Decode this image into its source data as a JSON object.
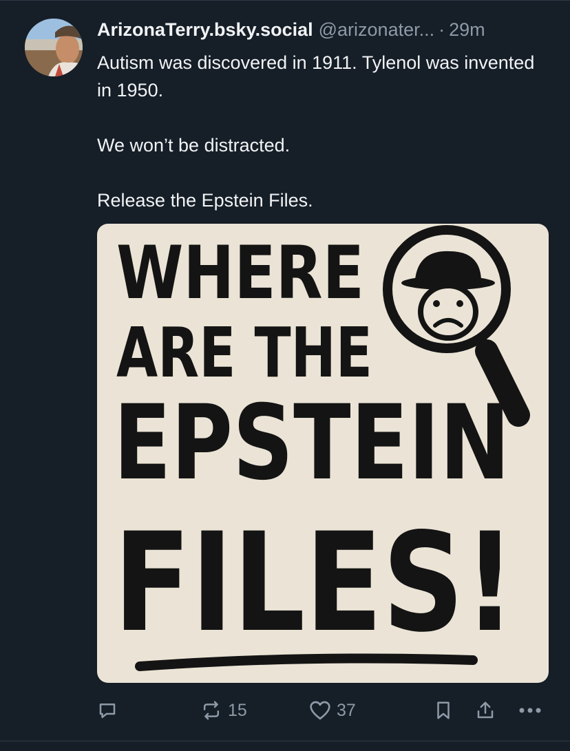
{
  "post": {
    "author": {
      "display_name": "ArizonaTerry.bsky.social",
      "handle": "@arizonater...",
      "separator": "·",
      "time": "29m"
    },
    "text": [
      "Autism was discovered in 1911. Tylenol was invented in 1950.",
      "We won’t be distracted.",
      "Release the Epstein Files."
    ],
    "image": {
      "line1": "WHERE",
      "line2": "ARE THE",
      "line3": "EPSTEIN",
      "line4": "FILES!",
      "icon": "magnifying-glass-with-frowning-man-in-hat"
    },
    "actions": {
      "reply_icon": "reply-icon",
      "repost_icon": "repost-icon",
      "repost_count": "15",
      "like_icon": "heart-icon",
      "like_count": "37",
      "bookmark_icon": "bookmark-icon",
      "share_icon": "share-icon",
      "more_icon": "more-icon"
    }
  },
  "colors": {
    "background": "#161e27",
    "text": "#f1f3f5",
    "muted": "#8d9aa8",
    "image_background": "#ebe4d6",
    "image_ink": "#141414"
  }
}
